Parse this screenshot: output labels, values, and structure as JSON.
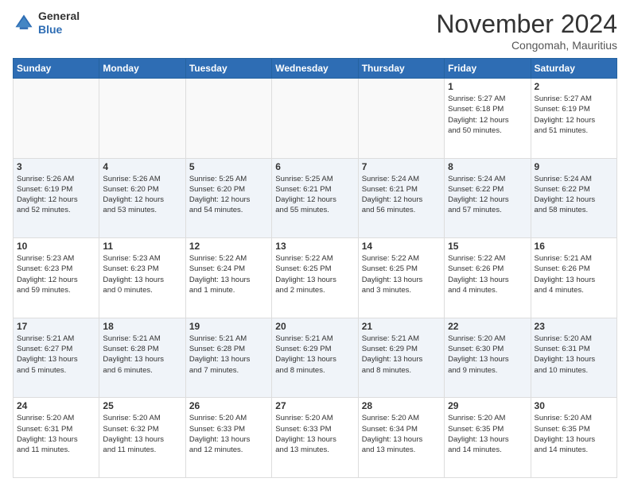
{
  "header": {
    "logo_line1": "General",
    "logo_line2": "Blue",
    "month": "November 2024",
    "location": "Congomah, Mauritius"
  },
  "weekdays": [
    "Sunday",
    "Monday",
    "Tuesday",
    "Wednesday",
    "Thursday",
    "Friday",
    "Saturday"
  ],
  "weeks": [
    [
      {
        "day": "",
        "info": ""
      },
      {
        "day": "",
        "info": ""
      },
      {
        "day": "",
        "info": ""
      },
      {
        "day": "",
        "info": ""
      },
      {
        "day": "",
        "info": ""
      },
      {
        "day": "1",
        "info": "Sunrise: 5:27 AM\nSunset: 6:18 PM\nDaylight: 12 hours\nand 50 minutes."
      },
      {
        "day": "2",
        "info": "Sunrise: 5:27 AM\nSunset: 6:19 PM\nDaylight: 12 hours\nand 51 minutes."
      }
    ],
    [
      {
        "day": "3",
        "info": "Sunrise: 5:26 AM\nSunset: 6:19 PM\nDaylight: 12 hours\nand 52 minutes."
      },
      {
        "day": "4",
        "info": "Sunrise: 5:26 AM\nSunset: 6:20 PM\nDaylight: 12 hours\nand 53 minutes."
      },
      {
        "day": "5",
        "info": "Sunrise: 5:25 AM\nSunset: 6:20 PM\nDaylight: 12 hours\nand 54 minutes."
      },
      {
        "day": "6",
        "info": "Sunrise: 5:25 AM\nSunset: 6:21 PM\nDaylight: 12 hours\nand 55 minutes."
      },
      {
        "day": "7",
        "info": "Sunrise: 5:24 AM\nSunset: 6:21 PM\nDaylight: 12 hours\nand 56 minutes."
      },
      {
        "day": "8",
        "info": "Sunrise: 5:24 AM\nSunset: 6:22 PM\nDaylight: 12 hours\nand 57 minutes."
      },
      {
        "day": "9",
        "info": "Sunrise: 5:24 AM\nSunset: 6:22 PM\nDaylight: 12 hours\nand 58 minutes."
      }
    ],
    [
      {
        "day": "10",
        "info": "Sunrise: 5:23 AM\nSunset: 6:23 PM\nDaylight: 12 hours\nand 59 minutes."
      },
      {
        "day": "11",
        "info": "Sunrise: 5:23 AM\nSunset: 6:23 PM\nDaylight: 13 hours\nand 0 minutes."
      },
      {
        "day": "12",
        "info": "Sunrise: 5:22 AM\nSunset: 6:24 PM\nDaylight: 13 hours\nand 1 minute."
      },
      {
        "day": "13",
        "info": "Sunrise: 5:22 AM\nSunset: 6:25 PM\nDaylight: 13 hours\nand 2 minutes."
      },
      {
        "day": "14",
        "info": "Sunrise: 5:22 AM\nSunset: 6:25 PM\nDaylight: 13 hours\nand 3 minutes."
      },
      {
        "day": "15",
        "info": "Sunrise: 5:22 AM\nSunset: 6:26 PM\nDaylight: 13 hours\nand 4 minutes."
      },
      {
        "day": "16",
        "info": "Sunrise: 5:21 AM\nSunset: 6:26 PM\nDaylight: 13 hours\nand 4 minutes."
      }
    ],
    [
      {
        "day": "17",
        "info": "Sunrise: 5:21 AM\nSunset: 6:27 PM\nDaylight: 13 hours\nand 5 minutes."
      },
      {
        "day": "18",
        "info": "Sunrise: 5:21 AM\nSunset: 6:28 PM\nDaylight: 13 hours\nand 6 minutes."
      },
      {
        "day": "19",
        "info": "Sunrise: 5:21 AM\nSunset: 6:28 PM\nDaylight: 13 hours\nand 7 minutes."
      },
      {
        "day": "20",
        "info": "Sunrise: 5:21 AM\nSunset: 6:29 PM\nDaylight: 13 hours\nand 8 minutes."
      },
      {
        "day": "21",
        "info": "Sunrise: 5:21 AM\nSunset: 6:29 PM\nDaylight: 13 hours\nand 8 minutes."
      },
      {
        "day": "22",
        "info": "Sunrise: 5:20 AM\nSunset: 6:30 PM\nDaylight: 13 hours\nand 9 minutes."
      },
      {
        "day": "23",
        "info": "Sunrise: 5:20 AM\nSunset: 6:31 PM\nDaylight: 13 hours\nand 10 minutes."
      }
    ],
    [
      {
        "day": "24",
        "info": "Sunrise: 5:20 AM\nSunset: 6:31 PM\nDaylight: 13 hours\nand 11 minutes."
      },
      {
        "day": "25",
        "info": "Sunrise: 5:20 AM\nSunset: 6:32 PM\nDaylight: 13 hours\nand 11 minutes."
      },
      {
        "day": "26",
        "info": "Sunrise: 5:20 AM\nSunset: 6:33 PM\nDaylight: 13 hours\nand 12 minutes."
      },
      {
        "day": "27",
        "info": "Sunrise: 5:20 AM\nSunset: 6:33 PM\nDaylight: 13 hours\nand 13 minutes."
      },
      {
        "day": "28",
        "info": "Sunrise: 5:20 AM\nSunset: 6:34 PM\nDaylight: 13 hours\nand 13 minutes."
      },
      {
        "day": "29",
        "info": "Sunrise: 5:20 AM\nSunset: 6:35 PM\nDaylight: 13 hours\nand 14 minutes."
      },
      {
        "day": "30",
        "info": "Sunrise: 5:20 AM\nSunset: 6:35 PM\nDaylight: 13 hours\nand 14 minutes."
      }
    ]
  ]
}
